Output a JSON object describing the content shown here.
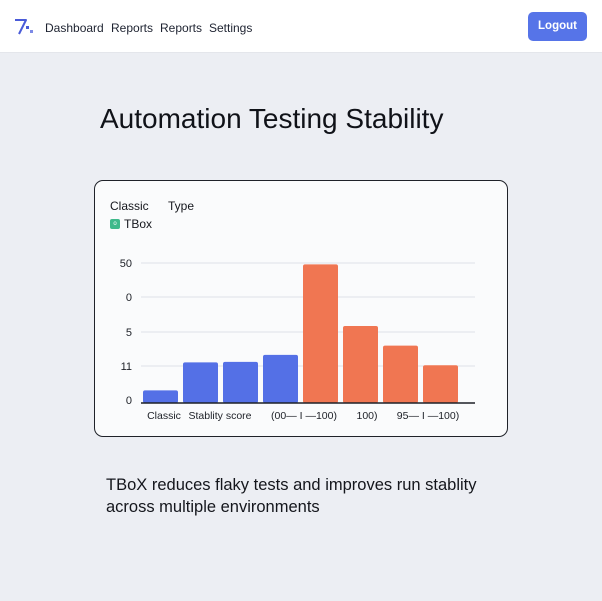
{
  "nav": {
    "items": [
      "Dashboard",
      "Reports",
      "Reports",
      "Settings"
    ],
    "logout_label": "Logout"
  },
  "page": {
    "title": "Automation Testing Stability"
  },
  "legend": {
    "header_left": "Classic",
    "header_right": "Type",
    "swatch_glyph": "o",
    "series_name": "TBox"
  },
  "chart_data": {
    "type": "bar",
    "title": "",
    "xlabel": "",
    "ylabel": "",
    "y_tick_labels": [
      "50",
      "0",
      "5",
      "11",
      "0"
    ],
    "x_tick_labels": [
      "Classic",
      "Stablity score",
      "(00— I —100)",
      "100)",
      "95— I —100)"
    ],
    "ylim": [
      0,
      50
    ],
    "grid": true,
    "bars": [
      {
        "value": 4.5,
        "color": "#5470e6"
      },
      {
        "value": 14.5,
        "color": "#5470e6"
      },
      {
        "value": 14.7,
        "color": "#5470e6"
      },
      {
        "value": 17.2,
        "color": "#5470e6"
      },
      {
        "value": 49.5,
        "color": "#f07652"
      },
      {
        "value": 27.5,
        "color": "#f07652"
      },
      {
        "value": 20.5,
        "color": "#f07652"
      },
      {
        "value": 13.5,
        "color": "#f07652"
      }
    ]
  },
  "footer": {
    "text": "TBoX reduces flaky tests and improves run stablity across multiple environments"
  },
  "colors": {
    "accent": "#5674e8",
    "blue_series": "#5470e6",
    "orange_series": "#f07652",
    "legend_swatch": "#3fb98b"
  }
}
